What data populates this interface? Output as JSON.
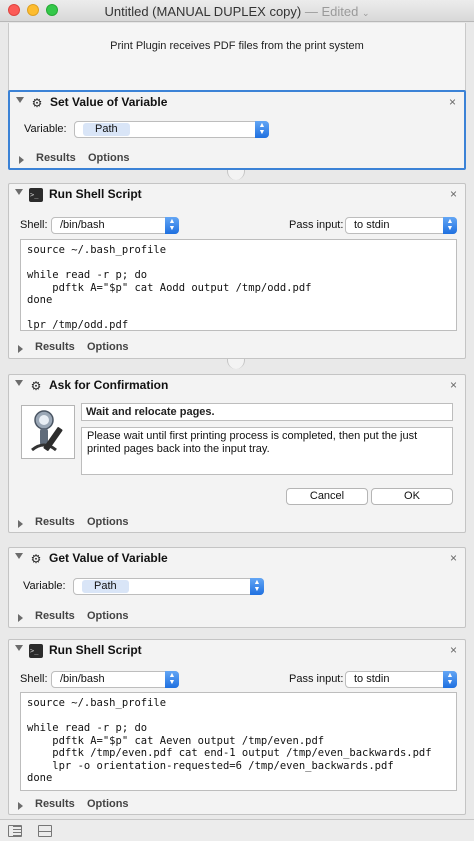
{
  "window": {
    "title": "Untitled (MANUAL DUPLEX copy)",
    "status": "— Edited",
    "status_chevron": "⌄"
  },
  "header": {
    "text": "Print Plugin receives PDF files from the print system"
  },
  "actions": [
    {
      "title": "Set Value of Variable",
      "icon": "variable-icon",
      "variable_label": "Variable:",
      "variable_value": "Path",
      "results_label": "Results",
      "options_label": "Options",
      "close": "×"
    },
    {
      "title": "Run Shell Script",
      "icon": "terminal-icon",
      "shell_label": "Shell:",
      "shell_value": "/bin/bash",
      "pass_input_label": "Pass input:",
      "pass_input_value": "to stdin",
      "script": "source ~/.bash_profile\n\nwhile read -r p; do\n    pdftk A=\"$p\" cat Aodd output /tmp/odd.pdf\ndone\n\nlpr /tmp/odd.pdf",
      "results_label": "Results",
      "options_label": "Options",
      "close": "×"
    },
    {
      "title": "Ask for Confirmation",
      "icon": "variable-icon",
      "dialog_title": "Wait and relocate pages.",
      "dialog_message": "Please wait until first printing process is completed, then put the just printed pages back into the input tray.",
      "cancel_label": "Cancel",
      "ok_label": "OK",
      "results_label": "Results",
      "options_label": "Options",
      "close": "×"
    },
    {
      "title": "Get Value of Variable",
      "icon": "variable-icon",
      "variable_label": "Variable:",
      "variable_value": "Path",
      "results_label": "Results",
      "options_label": "Options",
      "close": "×"
    },
    {
      "title": "Run Shell Script",
      "icon": "terminal-icon",
      "shell_label": "Shell:",
      "shell_value": "/bin/bash",
      "pass_input_label": "Pass input:",
      "pass_input_value": "to stdin",
      "script": "source ~/.bash_profile\n\nwhile read -r p; do\n    pdftk A=\"$p\" cat Aeven output /tmp/even.pdf\n    pdftk /tmp/even.pdf cat end-1 output /tmp/even_backwards.pdf\n    lpr -o orientation-requested=6 /tmp/even_backwards.pdf\ndone",
      "results_label": "Results",
      "options_label": "Options",
      "close": "×"
    }
  ],
  "colors": {
    "selection_border": "#3b82d6",
    "popup_stepper": "#1f70e0"
  }
}
